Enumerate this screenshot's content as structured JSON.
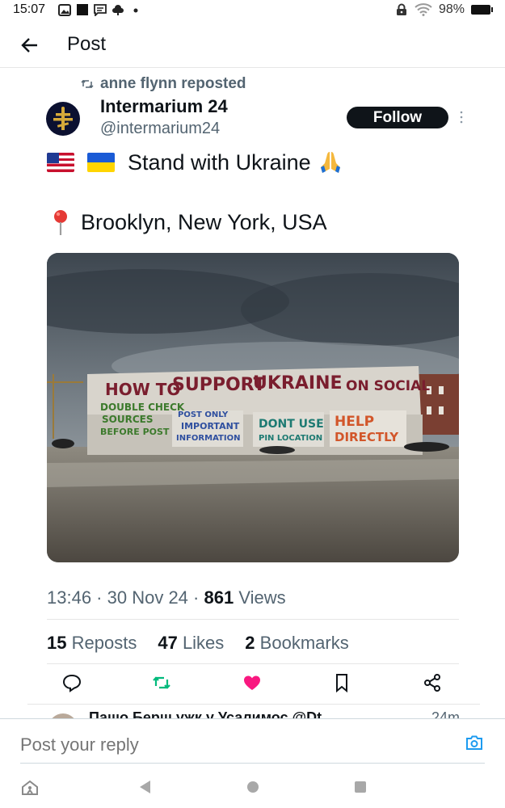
{
  "status_bar": {
    "time": "15:07",
    "battery": "98%"
  },
  "header": {
    "title": "Post"
  },
  "repost": {
    "text": "anne flynn reposted"
  },
  "author": {
    "name": "Intermarium 24",
    "handle": "@intermarium24",
    "follow_label": "Follow"
  },
  "post": {
    "line1_text": "Stand with Ukraine",
    "line2_text": "Brooklyn, New York, USA",
    "image_mural": {
      "top": [
        "HOW TO",
        "SUPPORT",
        "UKRAINE",
        "ON SOCIAL"
      ],
      "panel1": [
        "DOUBLE CHECK",
        "SOURCES",
        "BEFORE POST"
      ],
      "panel2": [
        "POST ONLY",
        "IMPORTANT",
        "INFORMATION"
      ],
      "panel3": [
        "DONT USE",
        "PIN LOCATION"
      ],
      "panel4": [
        "HELP",
        "DIRECTLY"
      ]
    }
  },
  "meta": {
    "time": "13:46",
    "date": "30 Nov 24",
    "views_count": "861",
    "views_label": "Views"
  },
  "stats": {
    "reposts_count": "15",
    "reposts_label": "Reposts",
    "likes_count": "47",
    "likes_label": "Likes",
    "bookmarks_count": "2",
    "bookmarks_label": "Bookmarks"
  },
  "reply_peek": {
    "name": "Пашо Берш ужк у Усалимос @Dt",
    "time": "24m"
  },
  "reply_bar": {
    "placeholder": "Post your reply"
  },
  "colors": {
    "accent": "#1d9bf0",
    "like": "#f91880",
    "repost": "#00ba7c",
    "secondary_text": "#536471"
  }
}
